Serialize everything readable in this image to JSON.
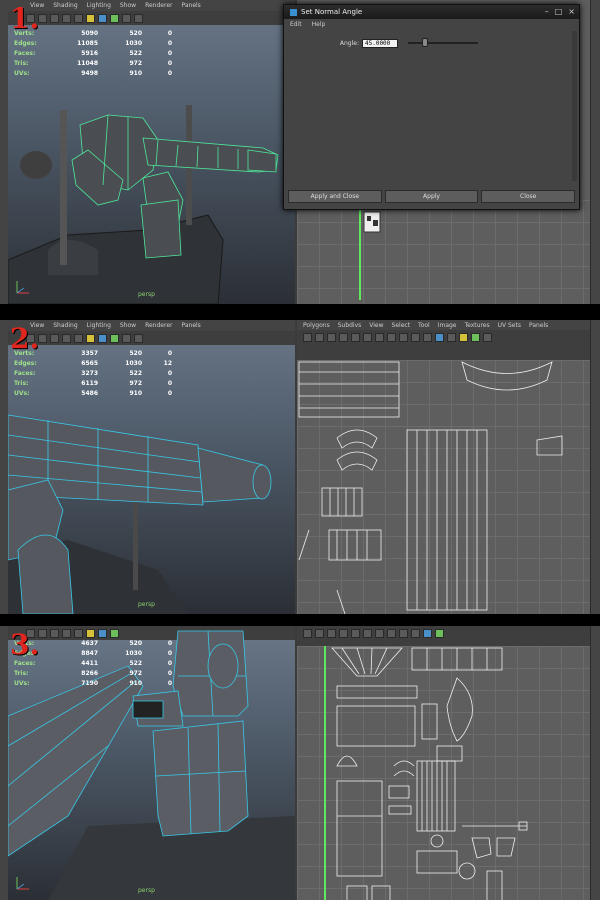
{
  "viewport_menu": [
    "View",
    "Shading",
    "Lighting",
    "Show",
    "Renderer",
    "Panels"
  ],
  "uv_menu": [
    "Polygons",
    "Subdivs",
    "View",
    "Select",
    "Tool",
    "Image",
    "Textures",
    "UV Sets",
    "Panels"
  ],
  "hud_labels": [
    "Verts:",
    "Edges:",
    "Faces:",
    "Tris:",
    "UVs:"
  ],
  "panels": [
    {
      "number": "1.",
      "camera": "persp",
      "hud": [
        [
          "5090",
          "520",
          "0"
        ],
        [
          "11085",
          "1030",
          "0"
        ],
        [
          "5916",
          "522",
          "0"
        ],
        [
          "11048",
          "972",
          "0"
        ],
        [
          "9498",
          "910",
          "0"
        ]
      ]
    },
    {
      "number": "2.",
      "camera": "persp",
      "hud": [
        [
          "3357",
          "520",
          "0"
        ],
        [
          "6565",
          "1030",
          "12"
        ],
        [
          "3273",
          "522",
          "0"
        ],
        [
          "6119",
          "972",
          "0"
        ],
        [
          "5486",
          "910",
          "0"
        ]
      ]
    },
    {
      "number": "3.",
      "camera": "persp",
      "hud": [
        [
          "4637",
          "520",
          "0"
        ],
        [
          "8847",
          "1030",
          "0"
        ],
        [
          "4411",
          "522",
          "0"
        ],
        [
          "8266",
          "972",
          "0"
        ],
        [
          "7190",
          "910",
          "0"
        ]
      ]
    }
  ],
  "dialog": {
    "title": "Set Normal Angle",
    "menu": [
      "Edit",
      "Help"
    ],
    "angle_label": "Angle:",
    "angle_value": "45.0000",
    "buttons": {
      "apply_close": "Apply and Close",
      "apply": "Apply",
      "close": "Close"
    }
  },
  "colors": {
    "hud_label": "#9fe28a",
    "panel_number": "#e0261f",
    "wireframe_selected": "#4de89a",
    "wireframe_edge": "#38c8e8"
  }
}
